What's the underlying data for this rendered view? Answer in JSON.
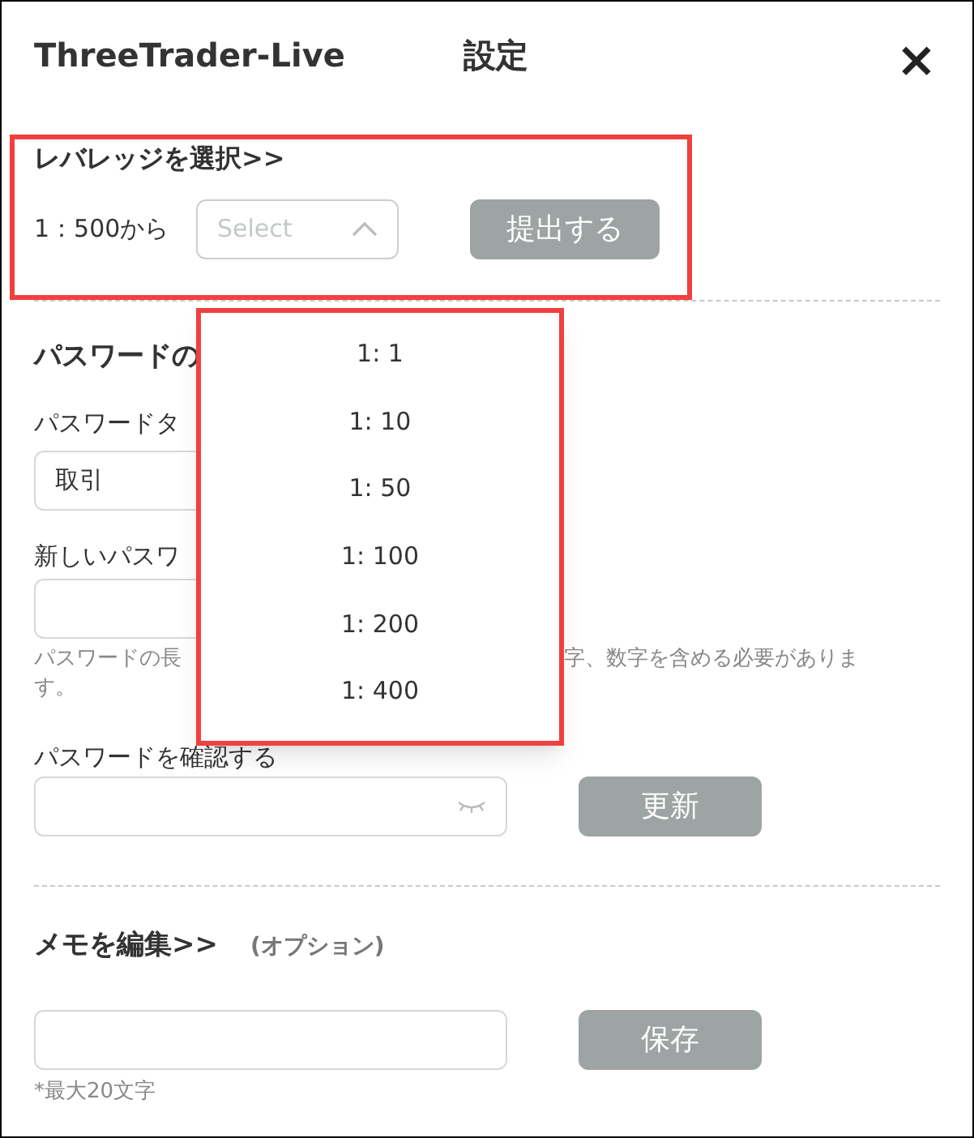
{
  "header": {
    "account": "ThreeTrader-Live",
    "title": "設定",
    "close": "×"
  },
  "leverage": {
    "heading": "レバレッジを選択>>",
    "current": "1：500から",
    "select": {
      "placeholder": "Select",
      "expanded": true
    },
    "submit": {
      "label": "提出する",
      "disabled": true
    },
    "options": [
      {
        "label": "1: 1",
        "selected": false
      },
      {
        "label": "1: 10",
        "selected": false
      },
      {
        "label": "1: 50",
        "selected": false
      },
      {
        "label": "1: 100",
        "selected": false
      },
      {
        "label": "1: 200",
        "selected": false
      },
      {
        "label": "1: 400",
        "selected": false
      }
    ]
  },
  "password": {
    "heading": "パスワードの",
    "type_label": "パスワードタ",
    "type_value": "取引",
    "new_label": "新しいパスワ",
    "hint_parts": [
      "パスワードの長",
      "字、数字を含める必要がありま",
      "す。"
    ],
    "confirm_label": "パスワードを確認する",
    "update": {
      "label": "更新",
      "disabled": true
    }
  },
  "memo": {
    "heading": "メモを編集>>",
    "optional": "(オプション)",
    "save": {
      "label": "保存",
      "disabled": true
    },
    "note": "*最大20文字"
  }
}
